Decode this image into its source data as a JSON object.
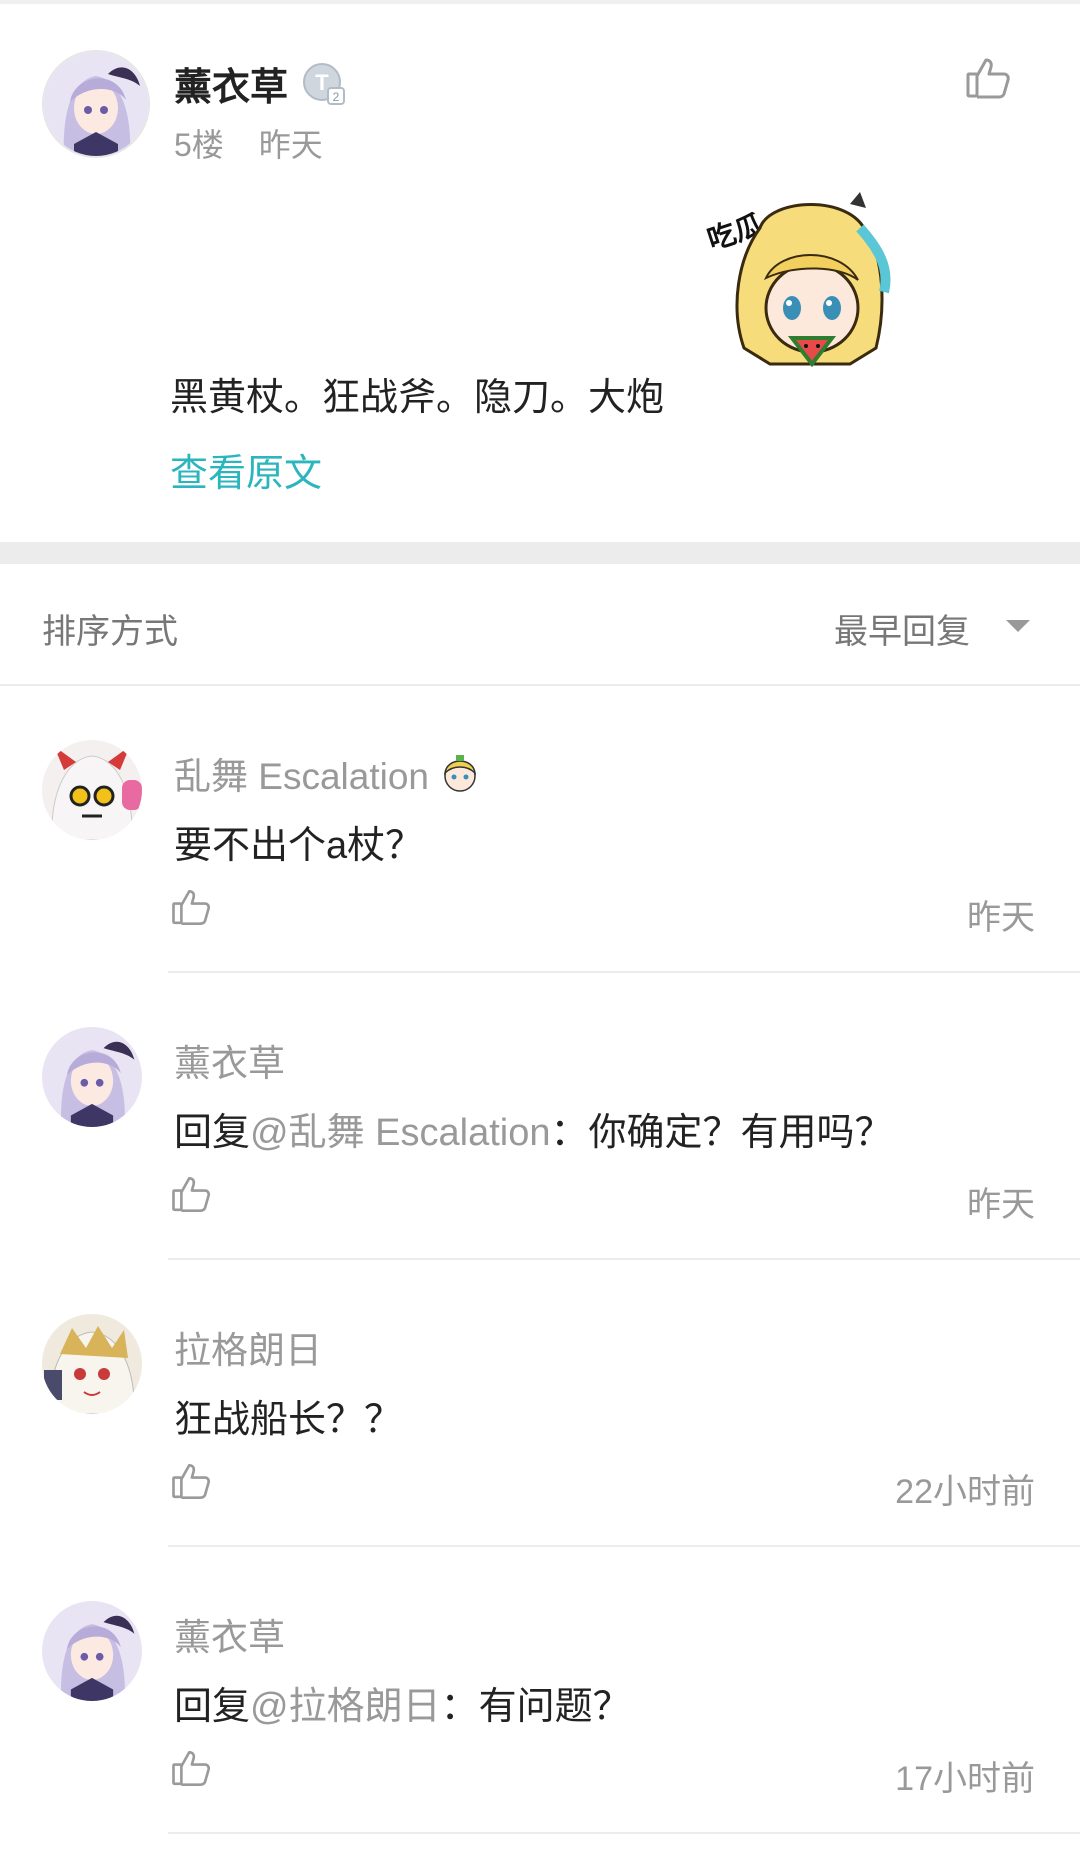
{
  "post": {
    "author": "薰衣草",
    "badge": "T",
    "badge_level": "2",
    "floor": "5楼",
    "time": "昨天",
    "text": "黑黄杖。狂战斧。隐刀。大炮",
    "sticker_text": "吃瓜…",
    "view_original": "查看原文"
  },
  "sort": {
    "label": "排序方式",
    "value": "最早回复"
  },
  "comments": [
    {
      "author": "乱舞 Escalation",
      "prefix": "",
      "mention": "",
      "text": "要不出个a杖？",
      "time": "昨天"
    },
    {
      "author": "薰衣草",
      "prefix": "回复",
      "mention": "@乱舞 Escalation",
      "text": "：你确定？有用吗？",
      "time": "昨天"
    },
    {
      "author": "拉格朗日",
      "prefix": "",
      "mention": "",
      "text": "狂战船长？？",
      "time": "22小时前"
    },
    {
      "author": "薰衣草",
      "prefix": "回复",
      "mention": "@拉格朗日",
      "text": "：有问题？",
      "time": "17小时前"
    }
  ],
  "colors": {
    "accent": "#2bb5bd",
    "muted": "#999999",
    "text": "#222222"
  },
  "icons": [
    "thumbs-up-icon",
    "caret-down-icon",
    "badge-icon"
  ]
}
